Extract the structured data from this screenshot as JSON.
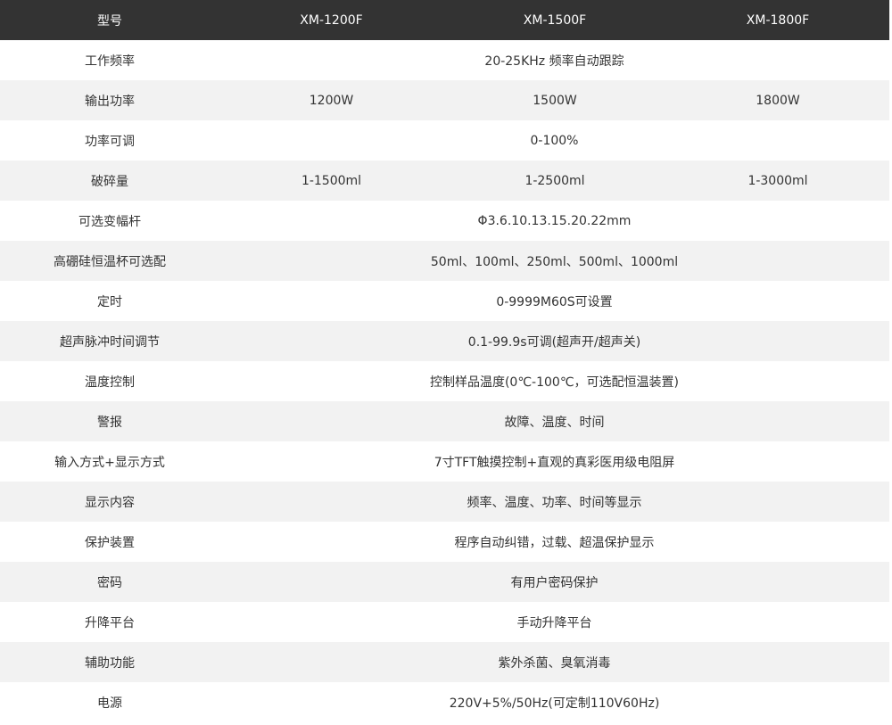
{
  "header": {
    "col0": "型号",
    "col1": "XM-1200F",
    "col2": "XM-1500F",
    "col3": "XM-1800F"
  },
  "rows": [
    {
      "label": "工作频率",
      "merged": "20-25KHz 频率自动跟踪"
    },
    {
      "label": "输出功率",
      "v1": "1200W",
      "v2": "1500W",
      "v3": "1800W"
    },
    {
      "label": "功率可调",
      "merged": "0-100%"
    },
    {
      "label": "破碎量",
      "v1": "1-1500ml",
      "v2": "1-2500ml",
      "v3": "1-3000ml"
    },
    {
      "label": "可选变幅杆",
      "merged": "Φ3.6.10.13.15.20.22mm"
    },
    {
      "label": "高硼硅恒温杯可选配",
      "merged": "50ml、100ml、250ml、500ml、1000ml"
    },
    {
      "label": "定时",
      "merged": "0-9999M60S可设置"
    },
    {
      "label": "超声脉冲时间调节",
      "merged": "0.1-99.9s可调(超声开/超声关)"
    },
    {
      "label": "温度控制",
      "merged": "控制样品温度(0℃-100℃，可选配恒温装置)"
    },
    {
      "label": "警报",
      "merged": "故障、温度、时间"
    },
    {
      "label": "输入方式+显示方式",
      "merged": "7寸TFT触摸控制+直观的真彩医用级电阻屏"
    },
    {
      "label": "显示内容",
      "merged": "频率、温度、功率、时间等显示"
    },
    {
      "label": "保护装置",
      "merged": "程序自动纠错，过载、超温保护显示"
    },
    {
      "label": "密码",
      "merged": "有用户密码保护"
    },
    {
      "label": "升降平台",
      "merged": "手动升降平台"
    },
    {
      "label": "辅助功能",
      "merged": "紫外杀菌、臭氧消毒"
    },
    {
      "label": "电源",
      "merged": "220V+5%/50Hz(可定制110V60Hz)"
    }
  ],
  "colors": {
    "header_bg": "#333333",
    "header_text": "#ffffff",
    "stripe": "#f2f2f2",
    "body_text": "#333333"
  }
}
